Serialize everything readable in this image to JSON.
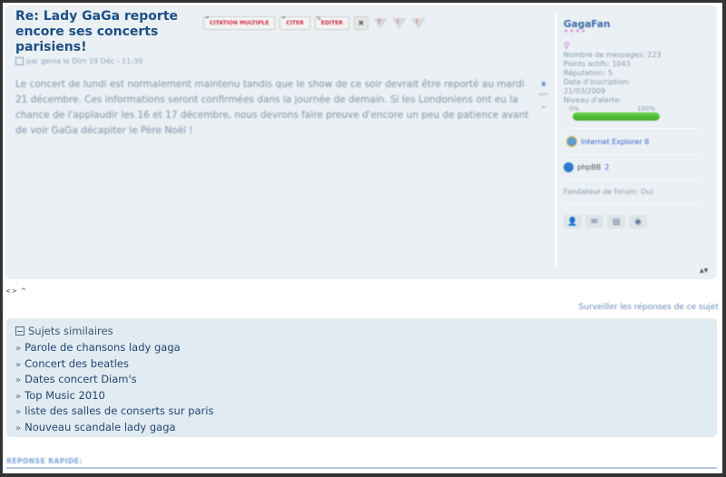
{
  "post": {
    "title": "Re: Lady GaGa reporte encore ses concerts parisiens!",
    "meta": "par genia le Dim 19 Déc - 11:39",
    "buttons": {
      "multi_quote": "CITATION MULTIPLE",
      "quote": "CITER",
      "edit": "EDITER"
    },
    "body": "Le concert de lundi est normalement maintenu tandis que le show de ce soir devrait être reporté au mardi 21 décembre. Ces informations seront confirmées dans la journée de demain. Si les Londoniens ont eu la chance de l'applaudir les 16 et 17 décembre, nous devrons faire preuve d'encore un peu de patience avant de voir GaGa décapiter le Père Noël !"
  },
  "profile": {
    "username": "GagaFan",
    "stars": "★★★★",
    "gender_icon": "♀",
    "stats": [
      "Nombre de messages: 223",
      "Points actifs: 1043",
      "Réputation: 5",
      "Date d'inscription:",
      "21/03/2009",
      "Niveau d'alerte:"
    ],
    "alert_min": "0%",
    "alert_max": "100%",
    "alert_level_percent": 100,
    "browser": "Internet Explorer 8",
    "forum_software": "phpBB",
    "forum_level": "2",
    "founder": "Fondateur de forum: Oui",
    "corner_text": "▲▼"
  },
  "nav": {
    "arrows": "<> ^"
  },
  "watch_link": "Surveiller les réponses de ce sujet",
  "similar": {
    "heading": "Sujets similaires",
    "items": [
      "Parole de chansons lady gaga",
      "Concert des beatles",
      "Dates concert Diam's",
      "Top Music 2010",
      "liste des salles de conserts sur paris",
      "Nouveau scandale lady gaga"
    ]
  },
  "quick_reply": "RÉPONSE RAPIDE:"
}
